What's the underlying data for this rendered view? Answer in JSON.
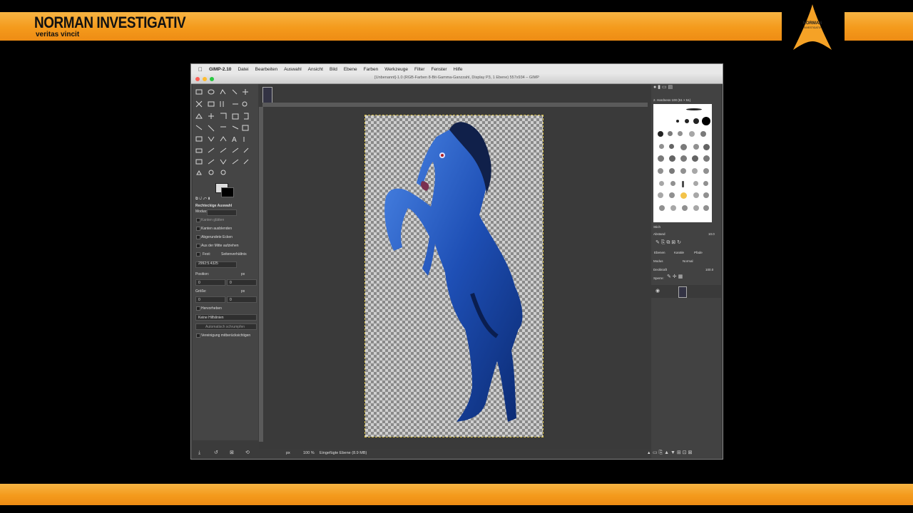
{
  "brand": {
    "title": "NORMAN INVESTIGATIV",
    "subtitle": "veritas vincit",
    "logo_text": "NORMAN",
    "logo_sub": "INVESTIGATIV"
  },
  "colors": {
    "band_orange": "#f49a1c",
    "window_bg": "#3b3b3b",
    "horse_blue": "#1e4fb5"
  },
  "menubar": {
    "app_name": "GIMP-2.10",
    "items": [
      "Datei",
      "Bearbeiten",
      "Auswahl",
      "Ansicht",
      "Bild",
      "Ebene",
      "Farben",
      "Werkzeuge",
      "Filter",
      "Fenster",
      "Hilfe"
    ]
  },
  "window": {
    "title": "[Unbenannt]-1.0 (RGB-Farben 8-Bit-Gamma-Ganzzahl, Display P3, 1 Ebene) 557x934 – GIMP"
  },
  "tool_options": {
    "title": "Rechteckige Auswahl",
    "mode_label": "Modus:",
    "antialias": "Kanten glätten",
    "feather": "Kanten ausblenden",
    "rounded": "Abgerundete Ecken",
    "from_center": "Aus der Mitte aufziehen",
    "fixed_label": "Fest:",
    "fixed_value": "Seitenverhältnis",
    "ratio_value": "2992:5.4325",
    "position_label": "Position:",
    "size_label": "Größe:",
    "unit": "px",
    "pos_x": "0",
    "pos_y": "0",
    "size_w": "0",
    "size_h": "0",
    "highlight": "Hervorheben",
    "guides": "Keine Hilfslinien",
    "auto_shrink": "Automatisch schrumpfen",
    "merged": "Vereinigung mitberücksichtigen"
  },
  "status": {
    "unit": "px",
    "zoom": "100 %",
    "message": "Eingefügte Ebene (8.9 MB)"
  },
  "dock": {
    "brush_name": "2. Hardness 100 (51 × 51)",
    "tag_placeholder": "Stich",
    "spacing_label": "Abstand",
    "spacing_value": "10.0",
    "tabs": [
      "Ebenen",
      "Kanäle",
      "Pfade"
    ],
    "mode_label": "Modus",
    "mode_value": "Normal",
    "opacity_label": "Deckkraft",
    "opacity_value": "100.0",
    "lock_label": "Sperre:"
  }
}
